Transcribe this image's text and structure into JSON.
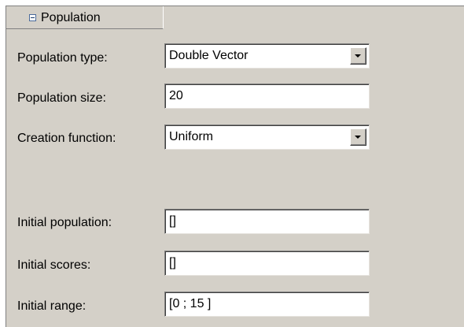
{
  "group": {
    "title": "Population",
    "toggle_icon": "collapse-minus-icon"
  },
  "rows": [
    {
      "label": "Population type:",
      "value": "Double Vector",
      "control": "dropdown"
    },
    {
      "label": "Population size:",
      "value": "20",
      "control": "text"
    },
    {
      "label": "Creation function:",
      "value": "Uniform",
      "control": "dropdown"
    },
    {
      "label": "Initial population:",
      "value": "[]",
      "control": "text"
    },
    {
      "label": "Initial scores:",
      "value": "[]",
      "control": "text"
    },
    {
      "label": "Initial range:",
      "value": "[0 ; 15 ]",
      "control": "text"
    }
  ],
  "colors": {
    "panel_background": "#d4d0c8",
    "field_background": "#ffffff",
    "border_dark": "#808080"
  }
}
